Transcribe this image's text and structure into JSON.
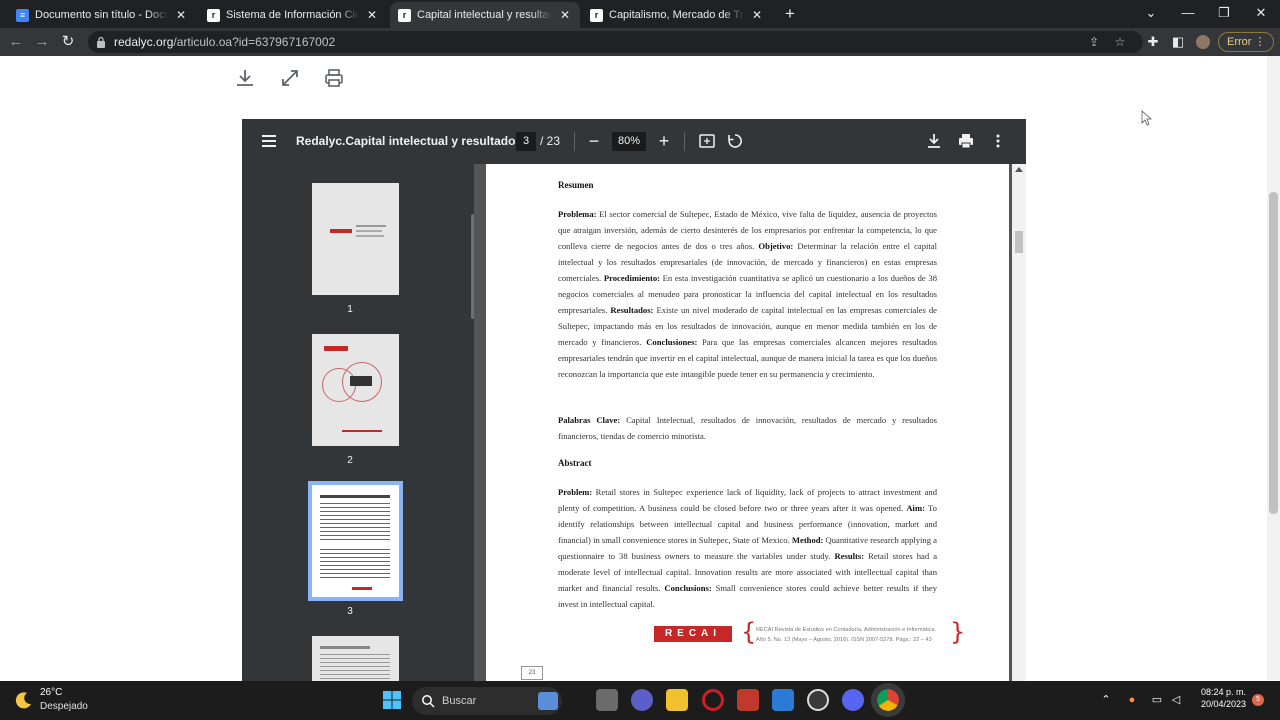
{
  "browser": {
    "tabs": [
      {
        "title": "Documento sin título - Documen",
        "icon": "google-docs-icon",
        "active": false
      },
      {
        "title": "Sistema de Información Científic",
        "icon": "redalyc-icon",
        "active": false
      },
      {
        "title": "Capital intelectual y resultados d",
        "icon": "redalyc-icon",
        "active": true
      },
      {
        "title": "Capitalismo, Mercado de Trabalh",
        "icon": "redalyc-icon",
        "active": false
      }
    ],
    "url_domain": "redalyc.org",
    "url_path": "/articulo.oa?id=637967167002",
    "error_label": "Error"
  },
  "viewer": {
    "title": "Redalyc.Capital intelectual y resultados...",
    "current_page": "3",
    "total_pages": "/ 23",
    "zoom": "80%",
    "thumbnails": [
      "1",
      "2",
      "3"
    ]
  },
  "document": {
    "resumen_heading": "Resumen",
    "problema_label": "Problema:",
    "problema_text": " El sector comercial de Sultepec, Estado de México,  vive falta de liquidez, ausencia de proyectos que atraigan inversión, además de cierto desinterés de los empresarios por enfrentar la competencia, lo que conlleva cierre de negocios antes de dos o tres años. ",
    "objetivo_label": "Objetivo:",
    "objetivo_text": " Determinar la relación entre el capital intelectual y los resultados empresariales (de innovación, de mercado y financieros) en estas empresas comerciales. ",
    "procedimiento_label": "Procedimiento:",
    "procedimiento_text": " En esta investigación cuantitativa se aplicó un cuestionario a los dueños de 38 negocios comerciales al menudeo para pronosticar la influencia del capital intelectual en los resultados empresariales. ",
    "resultados_label": "Resultados:",
    "resultados_text": " Existe un nivel moderado de capital intelectual en las empresas comerciales de Sultepec, impactando más en los resultados de innovación, aunque en menor medida también en los de mercado y financieros. ",
    "conclusiones_label": "Conclusiones:",
    "conclusiones_text": " Para que las empresas comerciales alcancen mejores resultados empresariales tendrán que invertir en el capital intelectual, aunque de manera inicial la tarea es que los dueños reconozcan la importancia que este intangible puede tener en su permanencia y crecimiento.",
    "palabras_label": "Palabras Clave:",
    "palabras_text": " Capital Intelectual, resultados de innovación, resultados de mercado y resultados financieros, tiendas de comercio minorista.",
    "abstract_heading": "Abstract",
    "problem_label": "Problem:",
    "problem_text": " Retail stores in Sultepec experience lack of liquidity, lack of projects to attract investment and plenty of competition. A business could be closed before two or three years after it was opened. ",
    "aim_label": "Aim:",
    "aim_text": " To identify relationships between intellectual capital and business performance (innovation, market and financial) in small convenience stores in Sultepec, State of Mexico. ",
    "method_label": "Method:",
    "method_text": " Quantitative research applying a questionnaire to 38 business owners to measure the variables under study. ",
    "results_label": "Results:",
    "results_text": " Retail stores had a moderate level of intellectual capital. Innovation results are more associated with intellectual capital than market and financial results. ",
    "conclusions_label": "Conclusions:",
    "conclusions_text": " Small convenience stores could achieve better results if they invest in intellectual capital.",
    "logo_text": "RECAI",
    "journal_line1": "RECAI Revista de Estudios en Contaduría, Administración e Informática.",
    "journal_line2": "Año 5, No. 13 (Mayo – Agosto, 2016). ISSN 2007-5278. Págs.: 22 – 43",
    "page_number": "23"
  },
  "taskbar": {
    "temperature": "26°C",
    "weather": "Despejado",
    "search_label": "Buscar",
    "time": "08:24 p. m.",
    "date": "20/04/2023",
    "notifications": "5"
  }
}
